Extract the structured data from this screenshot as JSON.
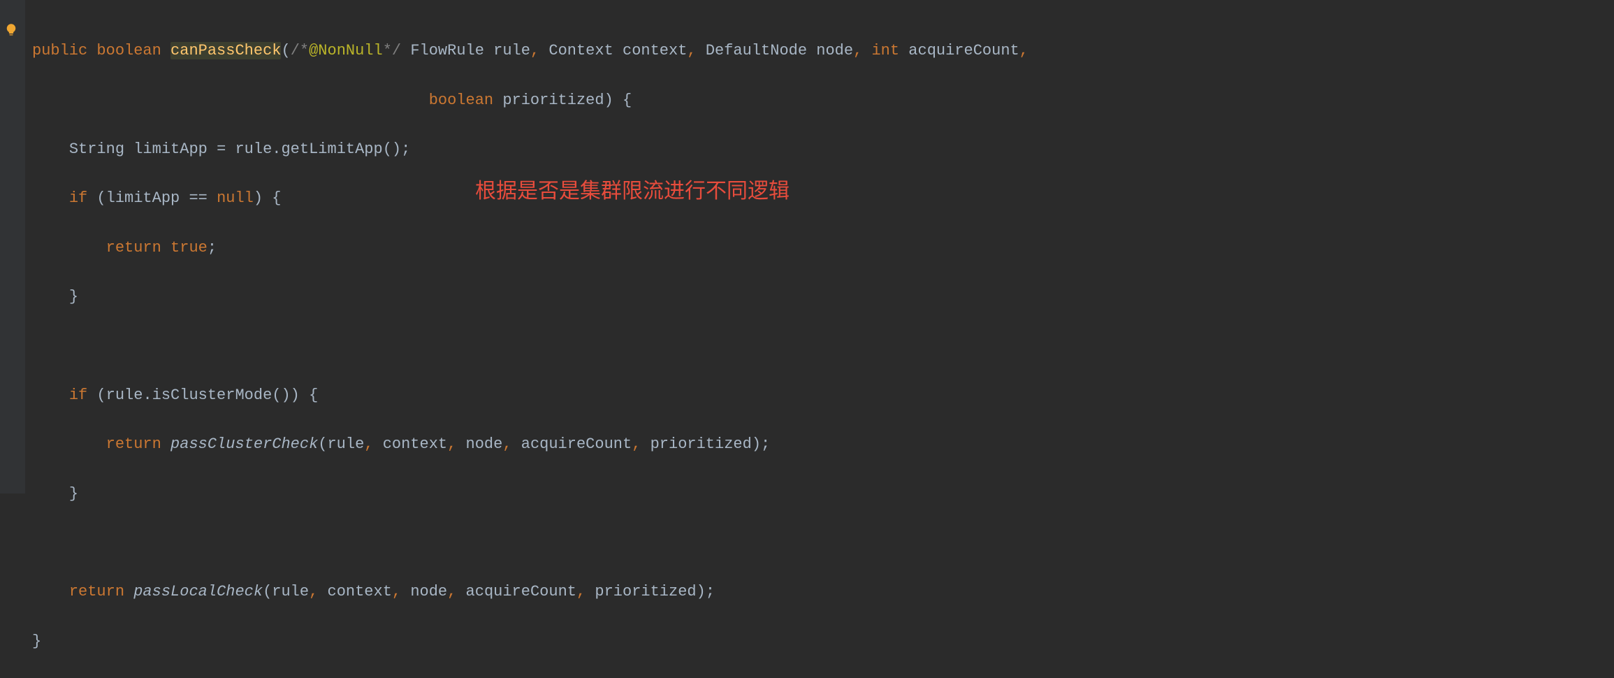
{
  "code": {
    "line1": {
      "public": "public",
      "boolean": "boolean",
      "method": "canPassCheck",
      "lparen": "(",
      "comment_open": "/*",
      "annotation": "@NonNull",
      "comment_close": "*/",
      "type1": "FlowRule",
      "param1": "rule",
      "comma1": ",",
      "type2": "Context",
      "param2": "context",
      "comma2": ",",
      "type3": "DefaultNode",
      "param3": "node",
      "comma3": ",",
      "type4": "int",
      "param4": "acquireCount",
      "comma4": ","
    },
    "line2": {
      "type5": "boolean",
      "param5": "prioritized",
      "rparen": ")",
      "lbrace": "{"
    },
    "line3": {
      "type": "String",
      "var": "limitApp",
      "eq": "=",
      "obj": "rule",
      "dot": ".",
      "method": "getLimitApp",
      "call": "();"
    },
    "line4": {
      "if": "if",
      "lparen": "(",
      "var": "limitApp",
      "eqeq": "==",
      "null": "null",
      "rparen": ")",
      "lbrace": "{"
    },
    "line5": {
      "return": "return",
      "true": "true",
      "semi": ";"
    },
    "line6": {
      "rbrace": "}"
    },
    "line8": {
      "if": "if",
      "lparen": "(",
      "obj": "rule",
      "dot": ".",
      "method": "isClusterMode",
      "call": "())",
      "lbrace": "{"
    },
    "line9": {
      "return": "return",
      "method": "passClusterCheck",
      "args": "(rule",
      "c1": ",",
      "a2": " context",
      "c2": ",",
      "a3": " node",
      "c3": ",",
      "a4": " acquireCount",
      "c4": ",",
      "a5": " prioritized);"
    },
    "line10": {
      "rbrace": "}"
    },
    "line12": {
      "return": "return",
      "method": "passLocalCheck",
      "args": "(rule",
      "c1": ",",
      "a2": " context",
      "c2": ",",
      "a3": " node",
      "c3": ",",
      "a4": " acquireCount",
      "c4": ",",
      "a5": " prioritized);"
    },
    "line13": {
      "rbrace": "}"
    }
  },
  "annotation": {
    "text": "根据是否是集群限流进行不同逻辑"
  }
}
